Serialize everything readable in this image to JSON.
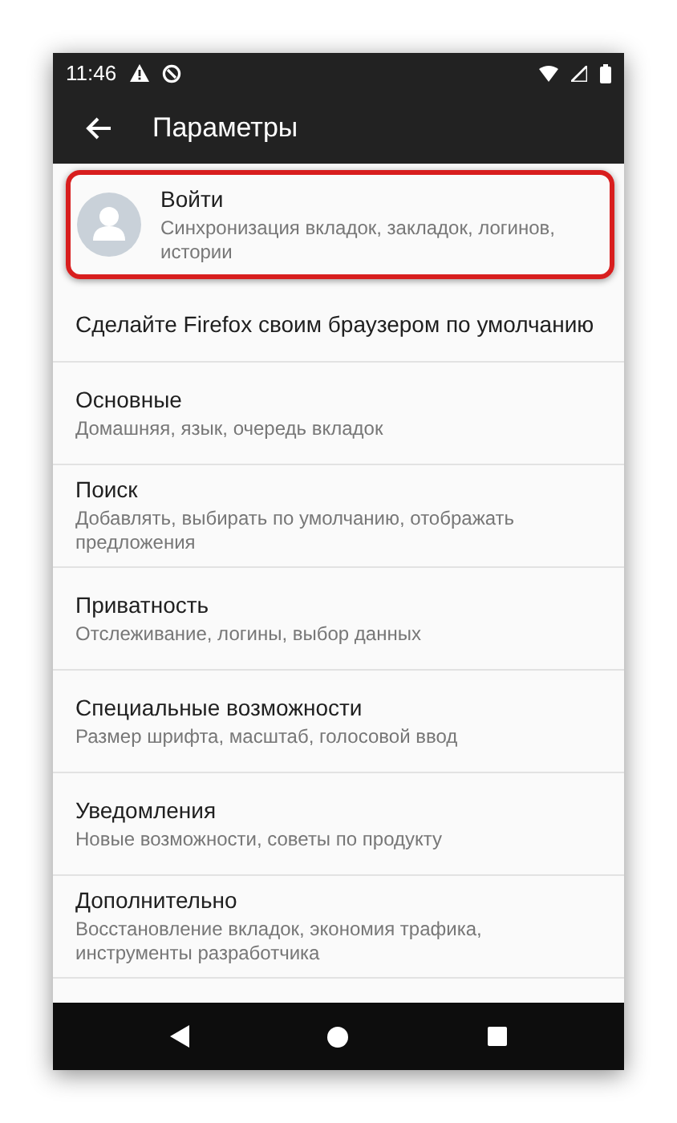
{
  "status_bar": {
    "time": "11:46"
  },
  "app_bar": {
    "title": "Параметры"
  },
  "items": [
    {
      "kind": "account",
      "title": "Войти",
      "subtitle": "Синхронизация вкладок, закладок, логинов, истории",
      "highlighted": true
    },
    {
      "kind": "single",
      "title": "Сделайте Firefox своим браузером по умолчанию",
      "highlighted": false
    },
    {
      "kind": "item",
      "title": "Основные",
      "subtitle": "Домашняя, язык, очередь вкладок",
      "highlighted": false
    },
    {
      "kind": "item",
      "title": "Поиск",
      "subtitle": "Добавлять, выбирать по умолчанию, отображать предложения",
      "highlighted": false
    },
    {
      "kind": "item",
      "title": "Приватность",
      "subtitle": "Отслеживание, логины, выбор данных",
      "highlighted": false
    },
    {
      "kind": "item",
      "title": "Специальные возможности",
      "subtitle": "Размер шрифта, масштаб, голосовой ввод",
      "highlighted": false
    },
    {
      "kind": "item",
      "title": "Уведомления",
      "subtitle": "Новые возможности, советы по продукту",
      "highlighted": false
    },
    {
      "kind": "item",
      "title": "Дополнительно",
      "subtitle": "Восстановление вкладок, экономия трафика, инструменты разработчика",
      "highlighted": false
    }
  ]
}
